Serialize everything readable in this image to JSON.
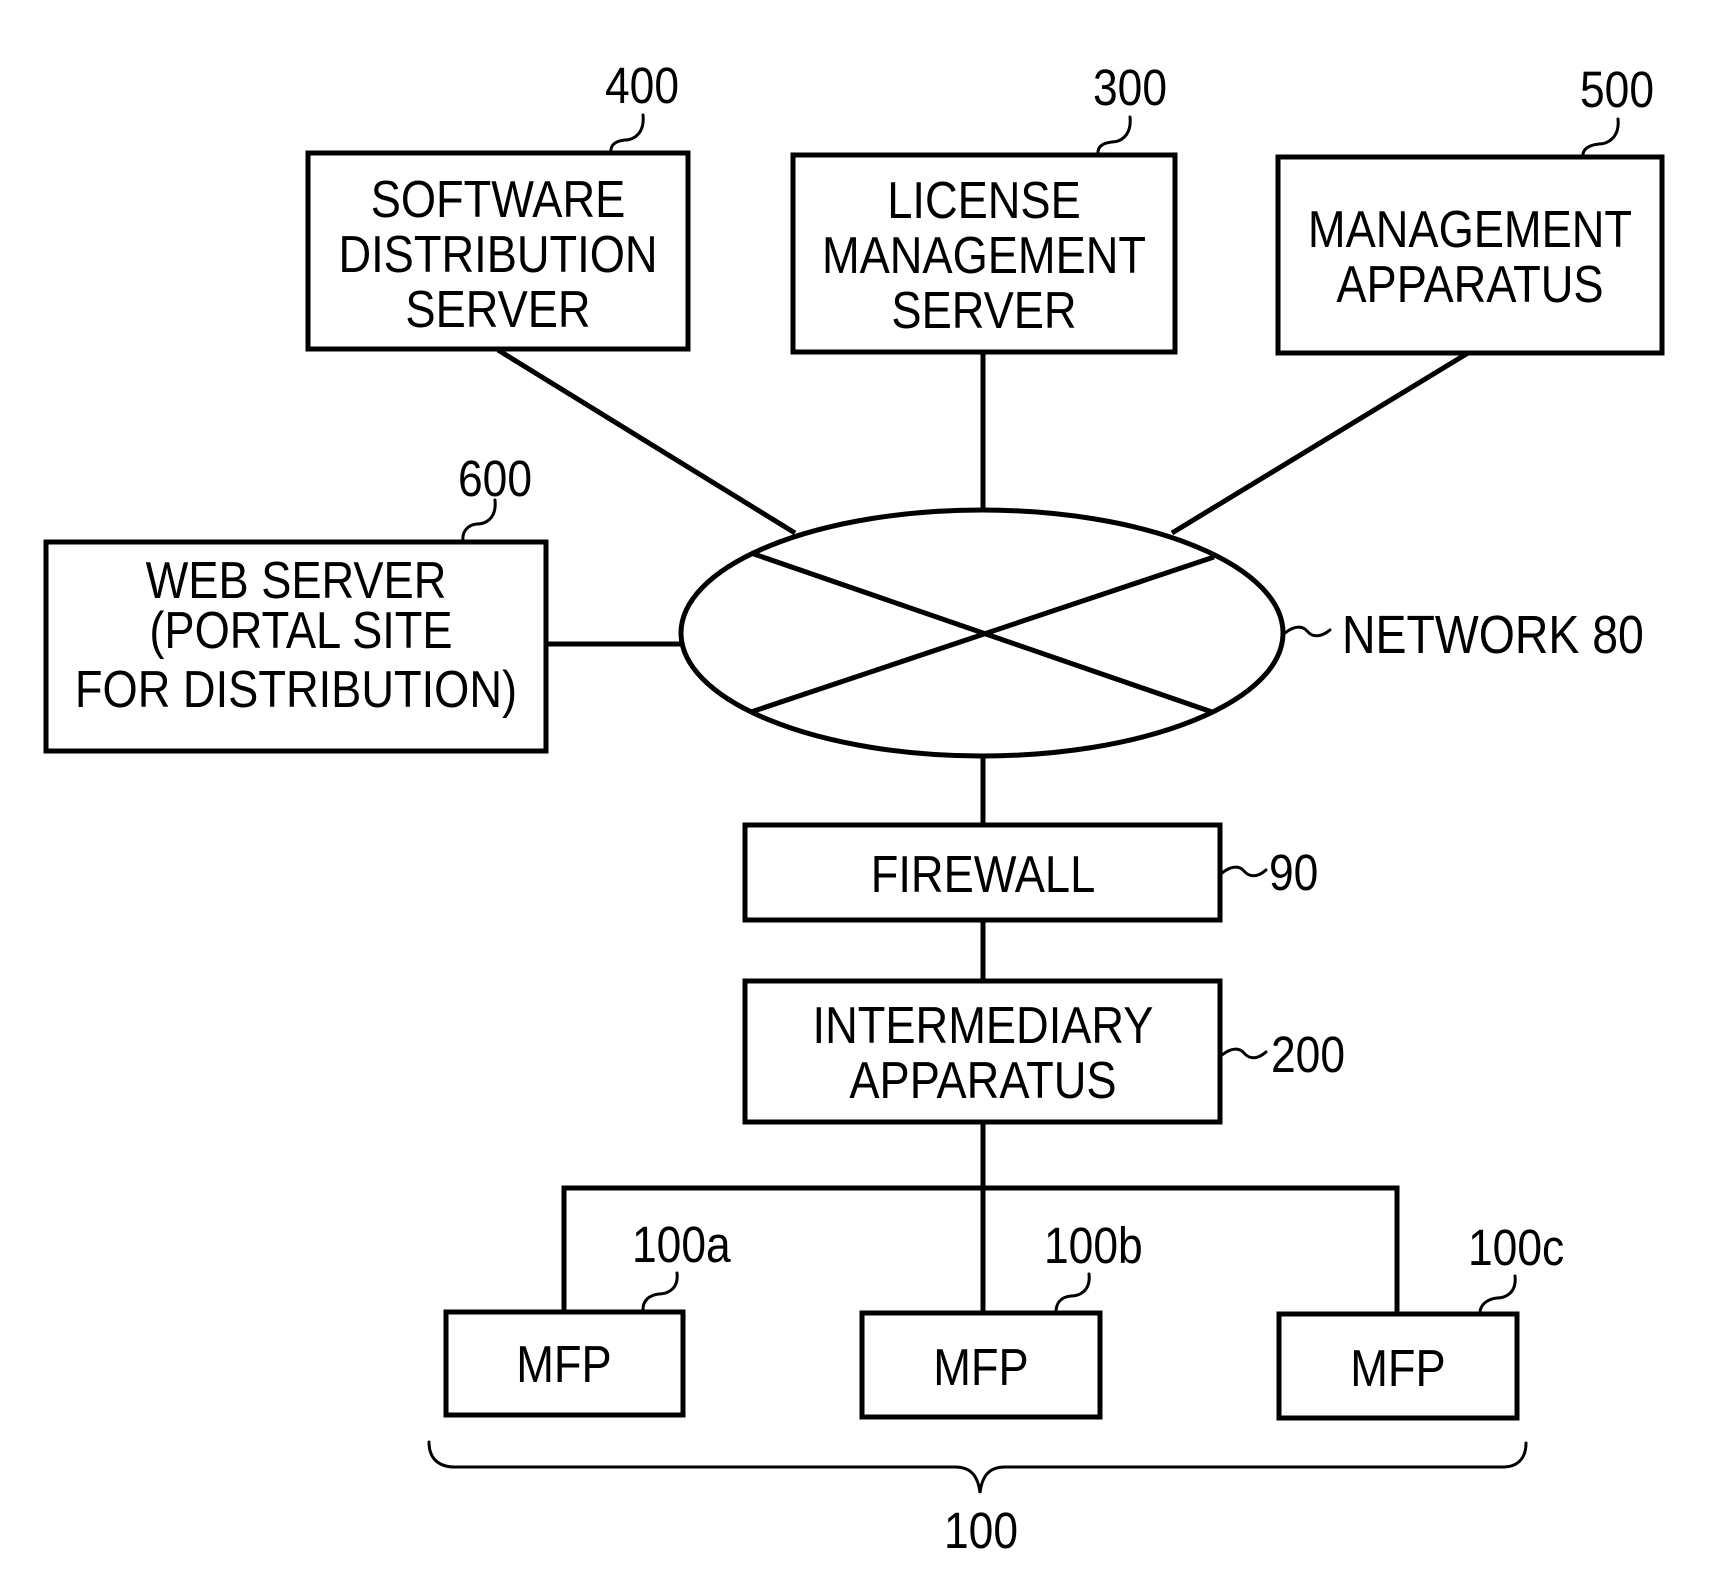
{
  "figure": {
    "nodes": {
      "software_distribution_server": {
        "ref": "400",
        "lines": [
          "SOFTWARE",
          "DISTRIBUTION",
          "SERVER"
        ]
      },
      "license_management_server": {
        "ref": "300",
        "lines": [
          "LICENSE",
          "MANAGEMENT",
          "SERVER"
        ]
      },
      "management_apparatus": {
        "ref": "500",
        "lines": [
          "MANAGEMENT",
          "APPARATUS"
        ]
      },
      "web_server": {
        "ref": "600",
        "lines": [
          "WEB SERVER",
          "(PORTAL SITE",
          "FOR DISTRIBUTION)"
        ]
      },
      "network": {
        "label": "NETWORK 80"
      },
      "firewall": {
        "ref": "90",
        "lines": [
          "FIREWALL"
        ]
      },
      "intermediary_apparatus": {
        "ref": "200",
        "lines": [
          "INTERMEDIARY",
          "APPARATUS"
        ]
      },
      "mfp_a": {
        "ref": "100a",
        "label": "MFP"
      },
      "mfp_b": {
        "ref": "100b",
        "label": "MFP"
      },
      "mfp_c": {
        "ref": "100c",
        "label": "MFP"
      },
      "mfp_group": {
        "ref": "100"
      }
    },
    "edges": [
      [
        "software_distribution_server",
        "network"
      ],
      [
        "license_management_server",
        "network"
      ],
      [
        "management_apparatus",
        "network"
      ],
      [
        "web_server",
        "network"
      ],
      [
        "network",
        "firewall"
      ],
      [
        "firewall",
        "intermediary_apparatus"
      ],
      [
        "intermediary_apparatus",
        "mfp_a"
      ],
      [
        "intermediary_apparatus",
        "mfp_b"
      ],
      [
        "intermediary_apparatus",
        "mfp_c"
      ]
    ]
  }
}
